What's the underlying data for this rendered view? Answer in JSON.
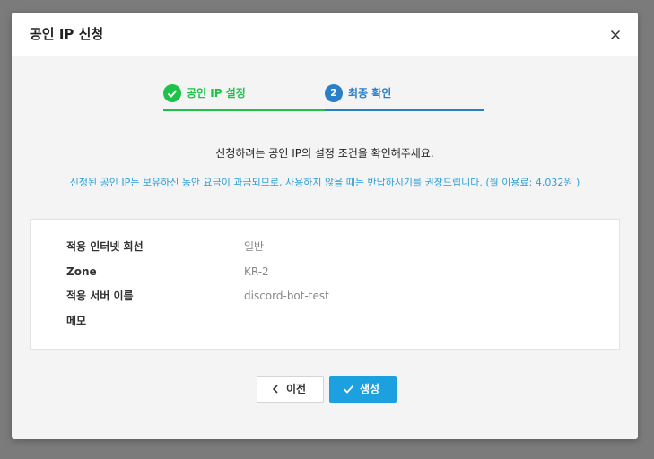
{
  "modal": {
    "title": "공인 IP 신청",
    "close_icon": "close-icon"
  },
  "steps": [
    {
      "label": "공인 IP 설정",
      "badge": "",
      "state": "completed",
      "icon": "check-icon"
    },
    {
      "label": "최종 확인",
      "badge": "2",
      "state": "active"
    }
  ],
  "notice": {
    "main": "신청하려는 공인 IP의 설정 조건을 확인해주세요.",
    "sub": "신청된 공인 IP는 보유하신 동안 요금이 과금되므로, 사용하지 않을 때는 반납하시기를 권장드립니다. (월 이용료: 4,032원 )"
  },
  "info": [
    {
      "label": "적용 인터넷 회선",
      "value": "일반"
    },
    {
      "label": "Zone",
      "value": "KR-2"
    },
    {
      "label": "적용 서버 이름",
      "value": "discord-bot-test"
    },
    {
      "label": "메모",
      "value": ""
    }
  ],
  "buttons": {
    "prev_label": "이전",
    "create_label": "생성"
  },
  "colors": {
    "completed": "#1fc14b",
    "active": "#2a7fc9",
    "primary": "#1da0e0",
    "notice_sub": "#2a9fd8"
  }
}
